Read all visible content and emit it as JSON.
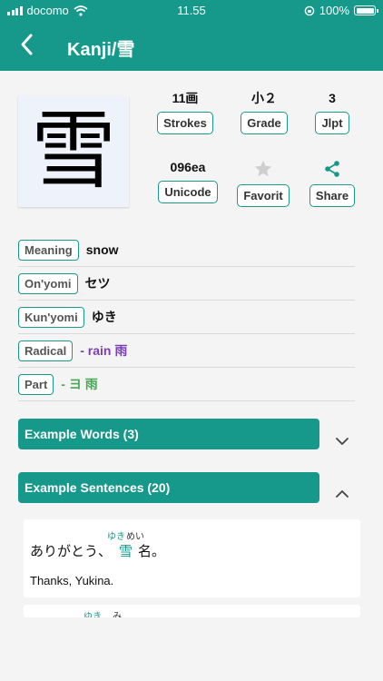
{
  "status": {
    "carrier": "docomo",
    "time": "11.55",
    "battery": "100%"
  },
  "header": {
    "title": "Kanji/雪",
    "back_icon": "chevron-left-icon"
  },
  "kanji": {
    "character": "雪"
  },
  "stats": {
    "strokes": {
      "value": "11画",
      "label": "Strokes"
    },
    "grade": {
      "value": "小２",
      "label": "Grade"
    },
    "jlpt": {
      "value": "3",
      "label": "Jlpt"
    },
    "unicode": {
      "value": "096ea",
      "label": "Unicode"
    },
    "favorite": {
      "icon": "star-icon",
      "label": "Favorit"
    },
    "share": {
      "icon": "share-icon",
      "label": "Share"
    }
  },
  "info": {
    "meaning": {
      "label": "Meaning",
      "value": "snow"
    },
    "onyomi": {
      "label": "On'yomi",
      "value": "セツ"
    },
    "kunyomi": {
      "label": "Kun'yomi",
      "value": "ゆき"
    },
    "radical": {
      "label": "Radical",
      "value": "- rain 雨"
    },
    "part": {
      "label": "Part",
      "value": "- ヨ 雨"
    }
  },
  "sections": {
    "words": {
      "label": "Example Words (3)",
      "state_icon": "chevron-down-icon"
    },
    "sentences": {
      "label": "Example Sentences (20)",
      "state_icon": "chevron-up-icon"
    }
  },
  "sentences": [
    {
      "pre": "ありがとう、",
      "kanji": "雪",
      "post": "名。",
      "reading_kanji": "ゆき",
      "reading_post": "めい",
      "translation": "Thanks, Yukina."
    },
    {
      "reading_kanji": "ゆき",
      "reading_post": "み"
    }
  ],
  "colors": {
    "accent": "#16998a",
    "radical": "#7b3fb5",
    "part": "#4aa657"
  }
}
